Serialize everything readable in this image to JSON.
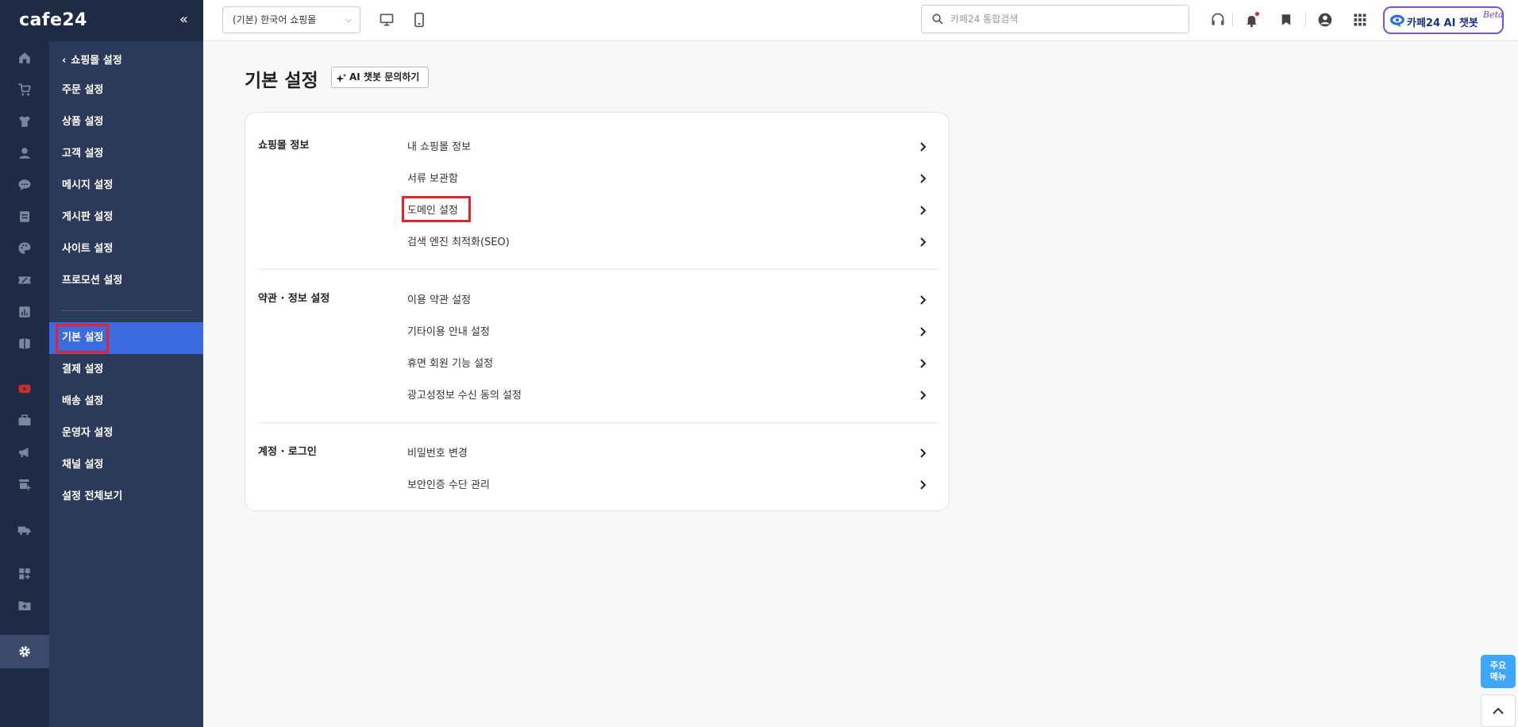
{
  "brand": {
    "logo_text": "cafe24",
    "collapse_icon": "double-chevron-left-icon"
  },
  "rail_icons": [
    "home-icon",
    "cart-icon",
    "shirt-icon",
    "person-icon",
    "chat-bubble-icon",
    "document-icon",
    "palette-icon",
    "ticket-icon",
    "chart-icon",
    "book-icon",
    "youtube-icon",
    "briefcase-icon",
    "megaphone-icon",
    "store-icon",
    "truck-icon",
    "apps-add-icon",
    "folder-icon",
    "gear-icon"
  ],
  "sidebar": {
    "back_label": "쇼핑몰 설정",
    "group1": [
      "주문 설정",
      "상품 설정",
      "고객 설정",
      "메시지 설정",
      "게시판 설정",
      "사이트 설정",
      "프로모션 설정"
    ],
    "group2": [
      "기본 설정",
      "결제 설정",
      "배송 설정",
      "운영자 설정",
      "채널 설정",
      "설정 전체보기"
    ],
    "active": "기본 설정"
  },
  "topbar": {
    "mall_select": "(기본) 한국어 쇼핑몰",
    "search_placeholder": "카페24 통합검색",
    "ai_button_label": "카페24 AI 챗봇",
    "ai_button_badge": "Beta"
  },
  "main": {
    "title": "기본 설정",
    "ai_chat_label": "AI 챗봇 문의하기",
    "sections": [
      {
        "title": "쇼핑몰 정보",
        "items": [
          "내 쇼핑몰 정보",
          "서류 보관함",
          "도메인 설정",
          "검색 엔진 최적화(SEO)"
        ]
      },
      {
        "title": "약관 · 정보 설정",
        "items": [
          "이용 약관 설정",
          "기타이용 안내 설정",
          "휴면 회원 기능 설정",
          "광고성정보 수신 동의 설정"
        ]
      },
      {
        "title": "계정 · 로그인",
        "items": [
          "비밀번호 변경",
          "보안인증 수단 관리"
        ]
      }
    ]
  },
  "floating": {
    "menu_label_1": "주요",
    "menu_label_2": "메뉴"
  },
  "colors": {
    "rail": "#1f2a44",
    "sidebar": "#2c3a59",
    "active": "#3c6be0",
    "highlight": "#e8212b",
    "ai_border": "#7a52e8"
  }
}
